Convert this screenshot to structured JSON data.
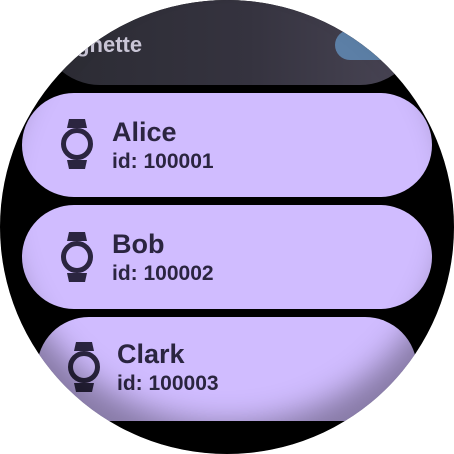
{
  "header": {
    "label": "ignette"
  },
  "devices": [
    {
      "name": "Alice",
      "id_text": "id: 100001"
    },
    {
      "name": "Bob",
      "id_text": "id: 100002"
    },
    {
      "name": "Clark",
      "id_text": "id: 100003"
    }
  ],
  "icons": {
    "device": "watch-icon"
  },
  "colors": {
    "card": "#d0bcff",
    "text": "#2b2540",
    "background": "#000000"
  }
}
